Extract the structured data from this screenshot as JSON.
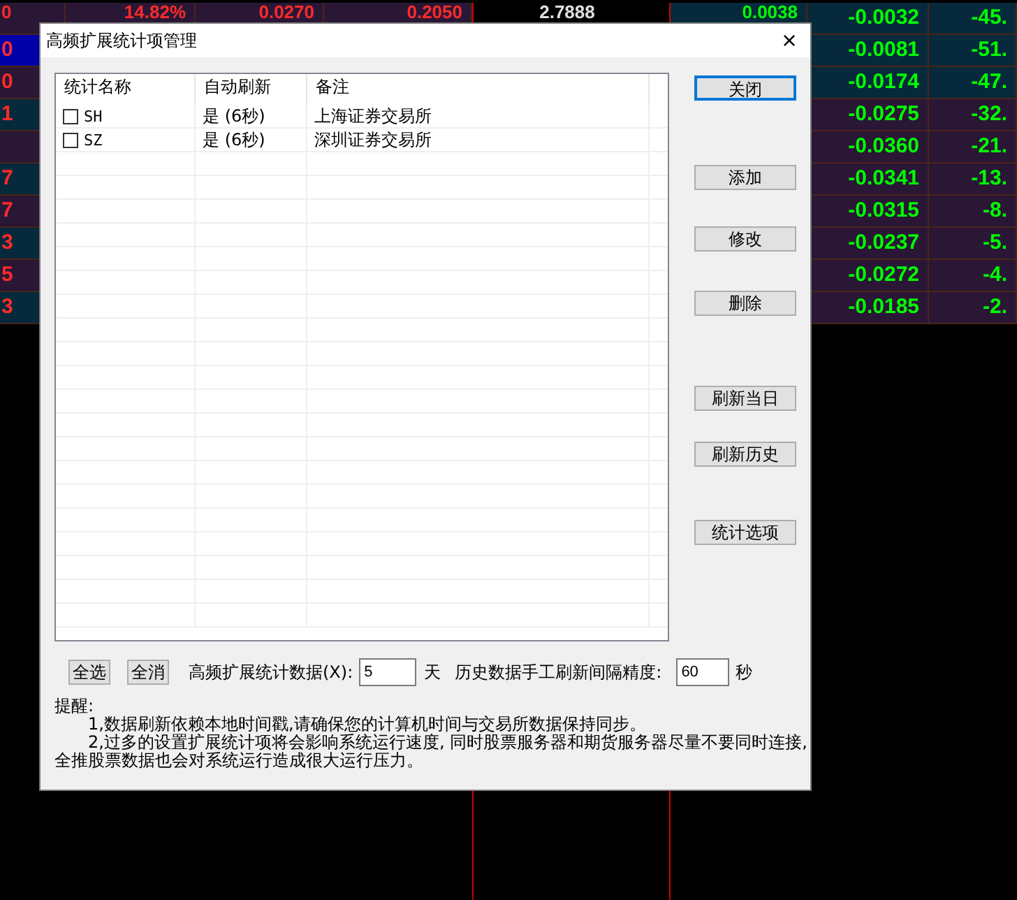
{
  "quote_table": {
    "rows": [
      {
        "selected": false,
        "edge": "0",
        "col_2": "14.82%",
        "col_3": "0.0270",
        "col_4": "0.2050",
        "col_5": "2.7888",
        "col_6": "0.0038",
        "col_7": "-0.0032",
        "col_8": "-45."
      },
      {
        "selected": true,
        "edge": "0",
        "col_7": "-0.0081",
        "col_8": "-51."
      },
      {
        "selected": false,
        "edge": "0",
        "col_7": "-0.0174",
        "col_8": "-47."
      },
      {
        "selected": false,
        "edge": "1",
        "col_7": "-0.0275",
        "col_8": "-32."
      },
      {
        "selected": false,
        "col_7": "-0.0360",
        "col_8": "-21."
      },
      {
        "selected": false,
        "edge": "7",
        "col_7": "-0.0341",
        "col_8": "-13."
      },
      {
        "selected": false,
        "edge": "7",
        "col_7": "-0.0315",
        "col_8": "-8."
      },
      {
        "selected": false,
        "edge": "3",
        "col_7": "-0.0237",
        "col_8": "-5."
      },
      {
        "selected": false,
        "edge": "5",
        "col_7": "-0.0272",
        "col_8": "-4."
      },
      {
        "selected": false,
        "edge": "3",
        "col_7": "-0.0185",
        "col_8": "-2."
      }
    ]
  },
  "dialog": {
    "title": "高频扩展统计项管理",
    "close": "×",
    "list": {
      "columns": [
        "统计名称",
        "自动刷新",
        "备注"
      ],
      "rows": [
        {
          "checked": false,
          "name": "SH",
          "auto_refresh": "是 (6秒)",
          "note": "上海证券交易所"
        },
        {
          "checked": false,
          "name": "SZ",
          "auto_refresh": "是 (6秒)",
          "note": "深圳证券交易所"
        }
      ]
    },
    "side_buttons": [
      {
        "label": "关闭",
        "focused": true
      },
      {
        "label": "添加",
        "focused": false
      },
      {
        "label": "修改",
        "focused": false
      },
      {
        "label": "删除",
        "focused": false
      },
      {
        "label": "刷新当日",
        "focused": false
      },
      {
        "label": "刷新历史",
        "focused": false
      },
      {
        "label": "统计选项",
        "focused": false
      }
    ],
    "select_all": "全选",
    "deselect_all": "全消",
    "days_label": "高频扩展统计数据(X):",
    "days_value": "5",
    "days_unit": "天",
    "interval_label": "历史数据手工刷新间隔精度:",
    "interval_value": "60",
    "interval_unit": "秒",
    "notes": [
      "提醒:",
      "1,数据刷新依赖本地时间戳,请确保您的计算机时间与交易所数据保持同步。",
      "2,过多的设置扩展统计项将会影响系统运行速度, 同时股票服务器和期货服务器尽量不要同时连接, 全推股票数据也会对系统运行造成很大运行压力。"
    ]
  }
}
